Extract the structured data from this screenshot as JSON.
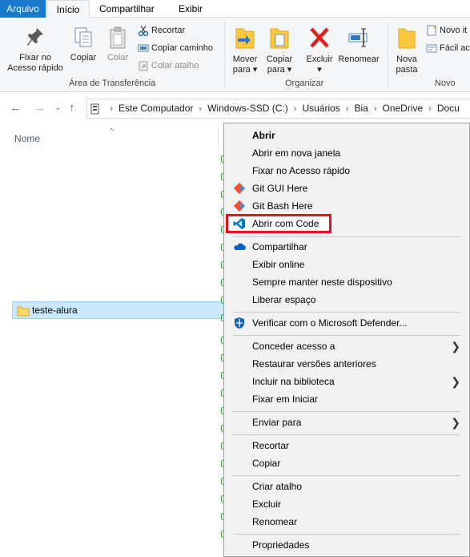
{
  "tabs": {
    "file": "Arquivo",
    "home": "Início",
    "share": "Compartilhar",
    "view": "Exibir"
  },
  "ribbon": {
    "pin_line1": "Fixar no",
    "pin_line2": "Acesso rápido",
    "copy": "Copiar",
    "paste": "Colar",
    "cut": "Recortar",
    "copy_path": "Copiar caminho",
    "paste_shortcut": "Colar atalho",
    "clipboard_group": "Área de Transferência",
    "move_line1": "Mover",
    "move_line2": "para ▾",
    "copyto_line1": "Copiar",
    "copyto_line2": "para ▾",
    "delete": "Excluir",
    "delete_arrow": "▾",
    "rename": "Renomear",
    "organize_group": "Organizar",
    "newfolder_line1": "Nova",
    "newfolder_line2": "pasta",
    "new_item": "Novo it",
    "easy_access": "Fácil ac",
    "new_group": "Novo"
  },
  "address": {
    "crumbs": [
      "Este Computador",
      "Windows-SSD (C:)",
      "Usuários",
      "Bia",
      "OneDrive",
      "Docu"
    ]
  },
  "file_list": {
    "column_name": "Nome",
    "items": [
      "teste-alura"
    ]
  },
  "context_menu": {
    "open": "Abrir",
    "open_new_window": "Abrir em nova janela",
    "pin_quick_access": "Fixar no Acesso rápido",
    "git_gui": "Git GUI Here",
    "git_bash": "Git Bash Here",
    "open_with_code": "Abrir com Code",
    "share": "Compartilhar",
    "view_online": "Exibir online",
    "always_keep": "Sempre manter neste dispositivo",
    "free_space": "Liberar espaço",
    "defender": "Verificar com o Microsoft Defender...",
    "grant_access": "Conceder acesso a",
    "restore_versions": "Restaurar versões anteriores",
    "include_library": "Incluir na biblioteca",
    "pin_start": "Fixar em Iniciar",
    "send_to": "Enviar para",
    "cut": "Recortar",
    "copy": "Copiar",
    "create_shortcut": "Criar atalho",
    "delete": "Excluir",
    "rename": "Renomear",
    "properties": "Propriedades"
  },
  "colors": {
    "file_tab": "#1979ca",
    "highlight_box": "#e0141e",
    "selection": "#cce8ff",
    "folder": "#ffd766"
  }
}
